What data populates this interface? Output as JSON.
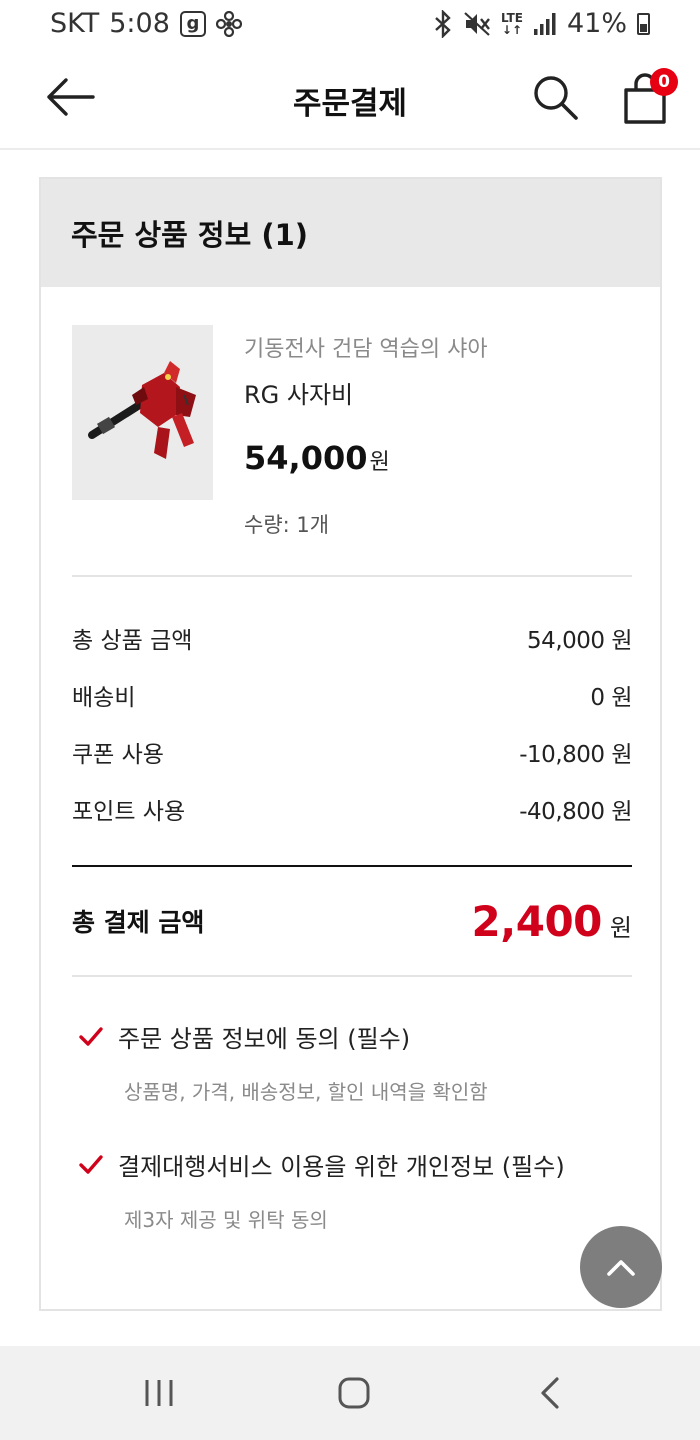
{
  "status_bar": {
    "carrier": "SKT",
    "time": "5:08",
    "g_badge": "g",
    "network": "LTE",
    "battery": "41%"
  },
  "header": {
    "title": "주문결제",
    "cart_count": "0",
    "back_icon": "arrow-left-icon",
    "search_icon": "search-icon",
    "cart_icon": "shopping-bag-icon"
  },
  "order": {
    "title": "주문 상품 정보 (1)",
    "product": {
      "series": "기동전사 건담 역습의 샤아",
      "name": "RG 사자비",
      "price": "54,000",
      "price_unit": "원",
      "quantity": "수량: 1개"
    },
    "summary": [
      {
        "label": "총 상품 금액",
        "value": "54,000 원"
      },
      {
        "label": "배송비",
        "value": "0 원"
      },
      {
        "label": "쿠폰 사용",
        "value": "-10,800 원"
      },
      {
        "label": "포인트 사용",
        "value": "-40,800 원"
      }
    ],
    "total": {
      "label": "총 결제 금액",
      "amount": "2,400",
      "unit": "원"
    },
    "agreements": [
      {
        "title": "주문 상품 정보에 동의 (필수)",
        "desc": "상품명, 가격, 배송정보, 할인 내역을 확인함"
      },
      {
        "title": "결제대행서비스 이용을 위한 개인정보 (필수)",
        "desc": "제3자 제공 및 위탁 동의"
      }
    ]
  },
  "colors": {
    "accent_red": "#d0021b",
    "badge_red": "#e60012",
    "header_gray": "#e8e8e8"
  }
}
